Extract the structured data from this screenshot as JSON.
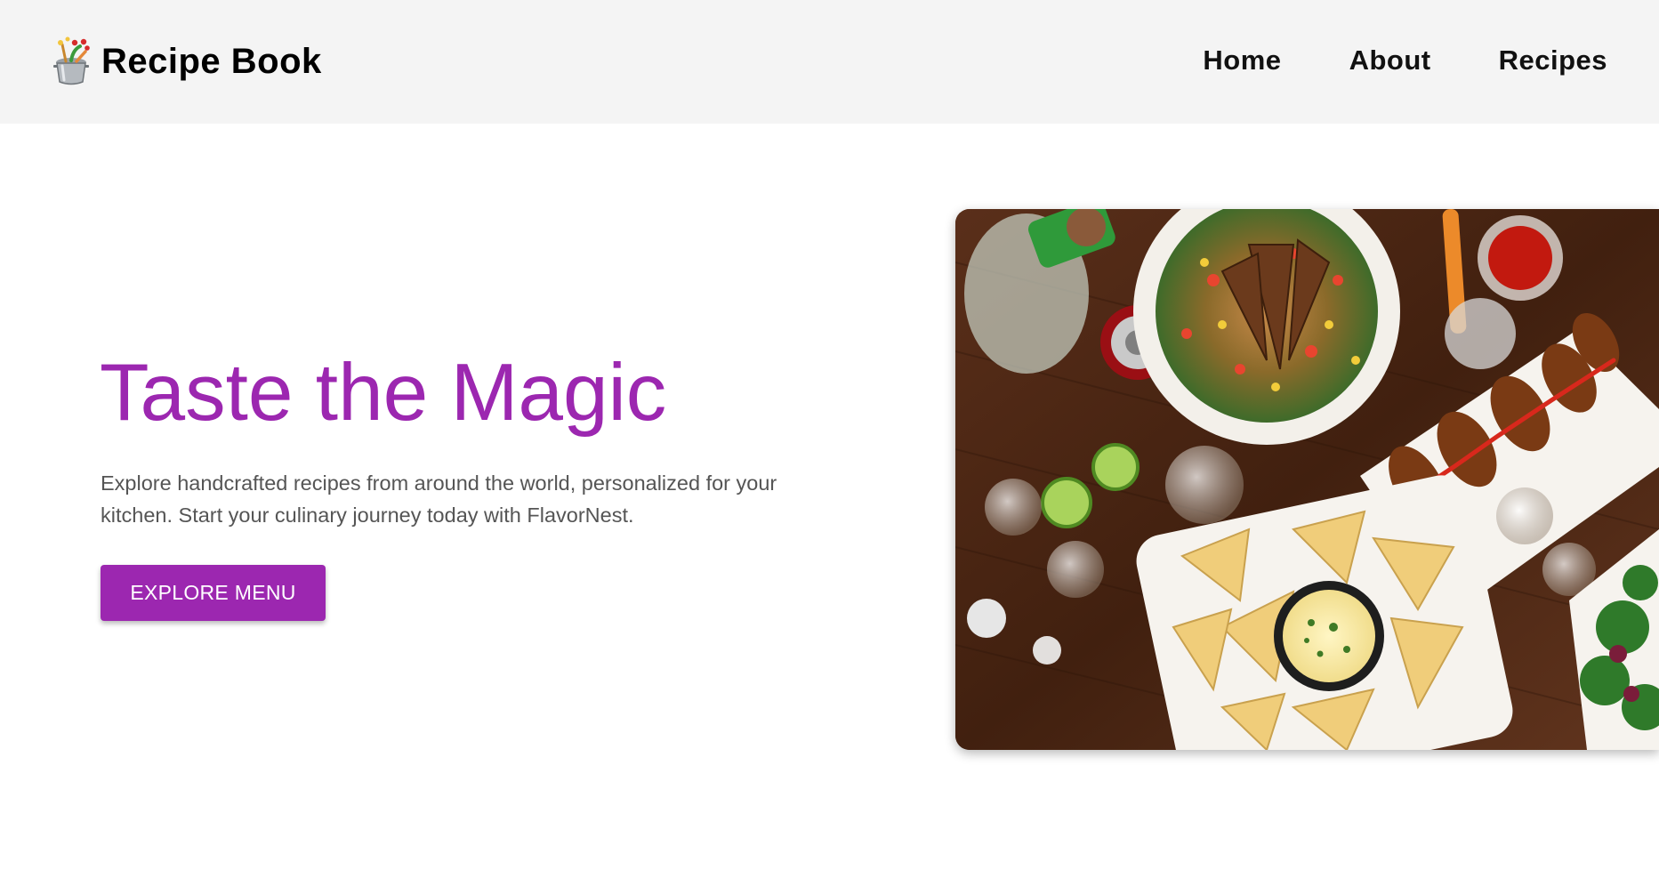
{
  "header": {
    "logo_icon": "cooking-pot-icon",
    "brand": "Recipe Book",
    "nav": [
      {
        "label": "Home"
      },
      {
        "label": "About"
      },
      {
        "label": "Recipes"
      }
    ]
  },
  "hero": {
    "title": "Taste the Magic",
    "description": "Explore handcrafted recipes from around the world, personalized for your kitchen. Start your culinary journey today with FlavorNest.",
    "cta_label": "EXPLORE MENU",
    "image_subject": "food-spread-photo"
  },
  "colors": {
    "accent": "#9c27b0",
    "header_bg": "#f4f4f4",
    "body_text": "#555555"
  }
}
